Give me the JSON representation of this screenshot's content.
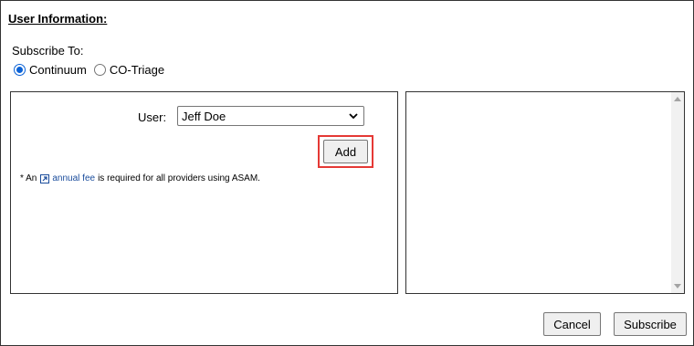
{
  "heading": "User Information:",
  "subscribe": {
    "label": "Subscribe To:",
    "options": [
      {
        "label": "Continuum",
        "checked": true
      },
      {
        "label": "CO-Triage",
        "checked": false
      }
    ]
  },
  "user": {
    "label": "User:",
    "selected": "Jeff Doe"
  },
  "add_label": "Add",
  "note": {
    "prefix": "* An",
    "link": "annual fee",
    "suffix": "is required for all providers using ASAM."
  },
  "footer": {
    "cancel_label": "Cancel",
    "subscribe_label": "Subscribe"
  },
  "colors": {
    "highlight": "#e53935",
    "link": "#1a4c9c",
    "radio_accent": "#0b62d6"
  }
}
